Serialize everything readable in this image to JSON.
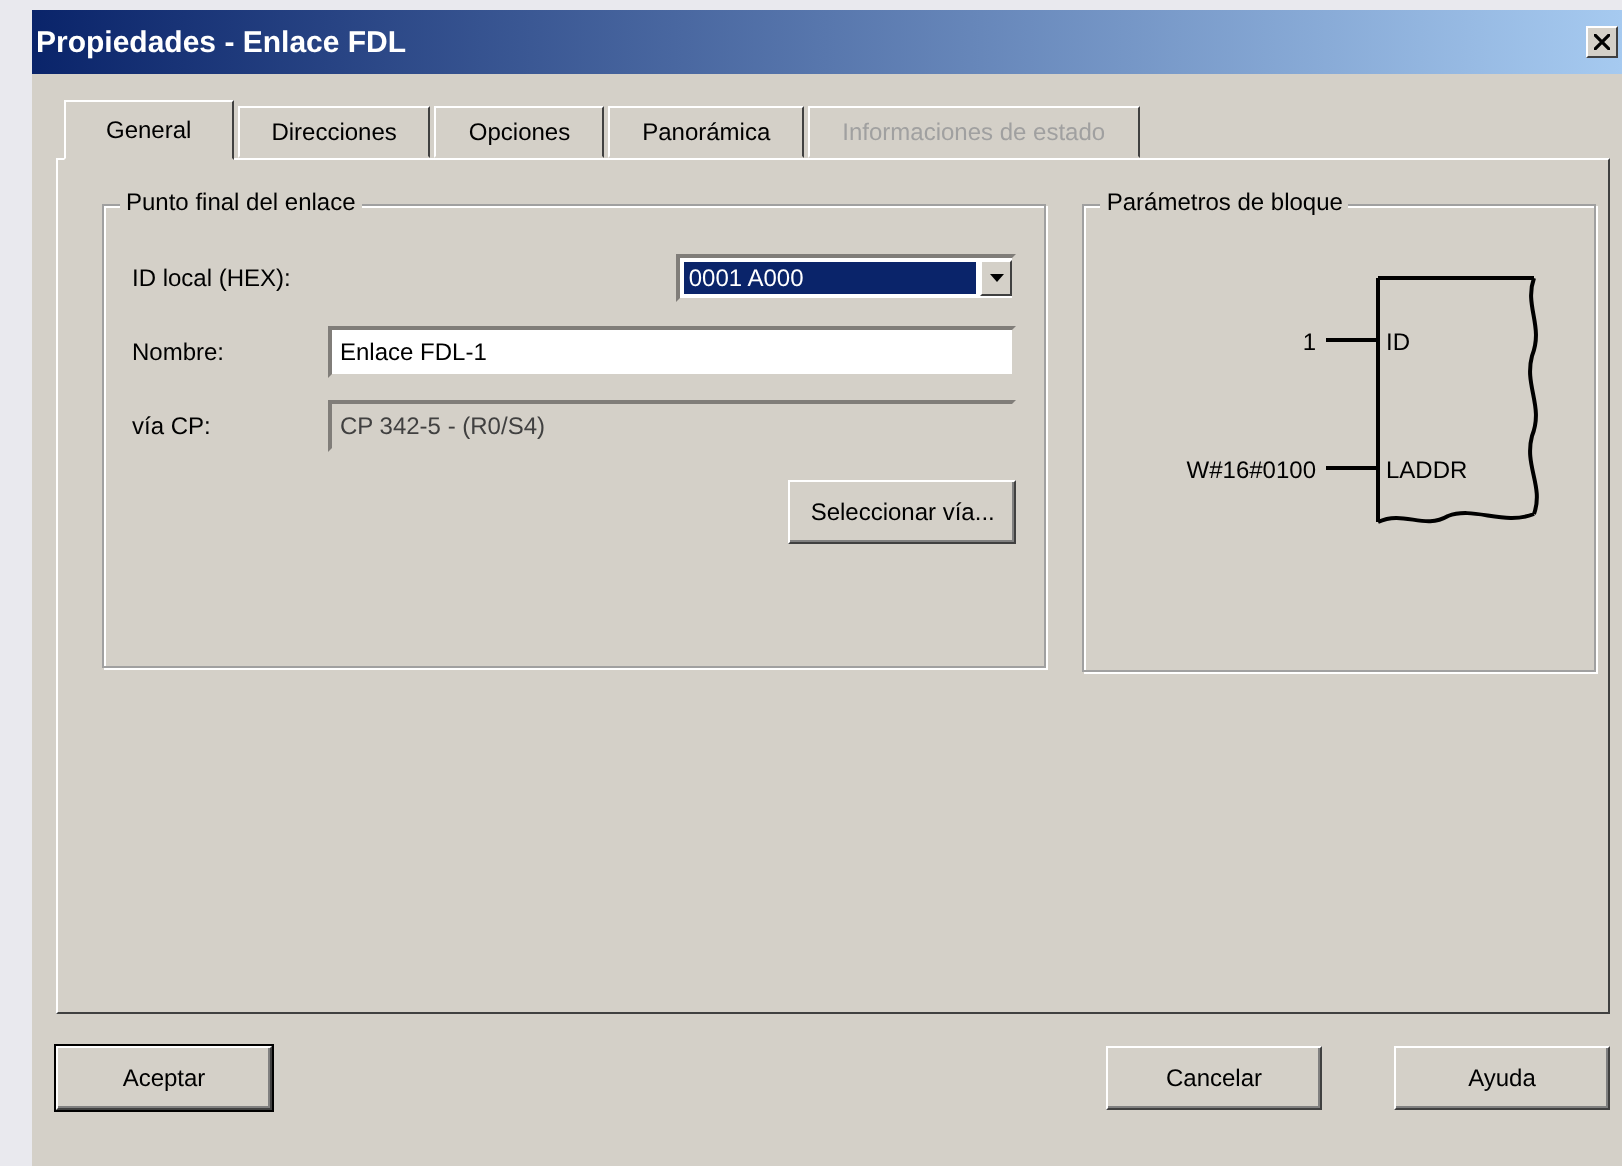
{
  "window": {
    "title": "Propiedades - Enlace FDL"
  },
  "tabs": [
    {
      "label": "General",
      "selected": true,
      "disabled": false
    },
    {
      "label": "Direcciones",
      "selected": false,
      "disabled": false
    },
    {
      "label": "Opciones",
      "selected": false,
      "disabled": false
    },
    {
      "label": "Panorámica",
      "selected": false,
      "disabled": false
    },
    {
      "label": "Informaciones de estado",
      "selected": false,
      "disabled": true
    }
  ],
  "endpoint_group": {
    "title": "Punto final del enlace",
    "fields": [
      {
        "kind": "combo",
        "label": "ID local (HEX):",
        "value": "0001 A000",
        "selected": true
      },
      {
        "kind": "text",
        "label": "Nombre:",
        "value": "Enlace FDL-1",
        "disabled": false
      },
      {
        "kind": "text",
        "label": "vía CP:",
        "value": "CP 342-5 - (R0/S4)",
        "disabled": true
      }
    ],
    "button": "Seleccionar vía..."
  },
  "block_group": {
    "title": "Parámetros de bloque",
    "pins": [
      {
        "value": "1",
        "name": "ID"
      },
      {
        "value": "W#16#0100",
        "name": "LADDR"
      }
    ]
  },
  "buttons": [
    {
      "label": "Aceptar",
      "default": true
    },
    {
      "label": "Cancelar",
      "default": false
    },
    {
      "label": "Ayuda",
      "default": false
    }
  ]
}
